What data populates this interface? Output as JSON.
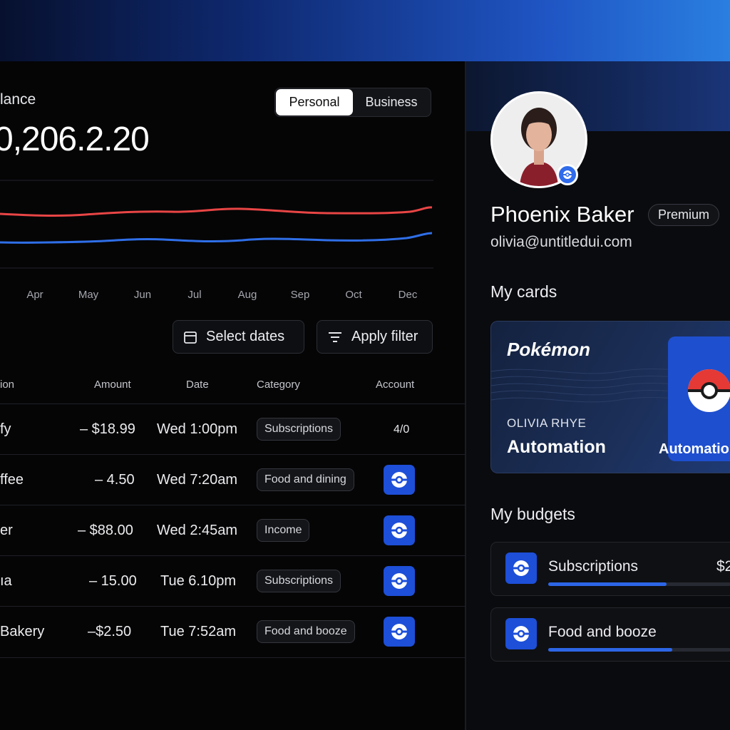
{
  "balance": {
    "label": "lance",
    "amount": "0,206.2.20",
    "toggle": {
      "personal": "Personal",
      "business": "Business",
      "active": "personal"
    }
  },
  "chart": {
    "months": [
      "Apr",
      "May",
      "Jun",
      "Jul",
      "Aug",
      "Sep",
      "Oct",
      "Dec"
    ],
    "colors": {
      "red": "#e94545",
      "blue": "#2f6fe8"
    }
  },
  "actions": {
    "select_dates": "Select dates",
    "apply_filter": "Apply filter"
  },
  "table": {
    "headers": {
      "description": "ion",
      "amount": "Amount",
      "date": "Date",
      "category": "Category",
      "account": "Account"
    },
    "rows": [
      {
        "name": "fy",
        "amount": "– $18.99",
        "date": "Wed 1:00pm",
        "category": "Subscriptions",
        "account_text": "4/0",
        "account_icon": "pokeball-icon"
      },
      {
        "name": "ffee",
        "amount": "– 4.50",
        "date": "Wed 7:20am",
        "category": "Food and dining",
        "account_text": "",
        "account_icon": "pokeball-icon"
      },
      {
        "name": "er",
        "amount": "– $88.00",
        "date": "Wed 2:45am",
        "category": "Income",
        "account_text": "",
        "account_icon": "pokeball-icon"
      },
      {
        "name": "ıa",
        "amount": "– 15.00",
        "date": "Tue 6.10pm",
        "category": "Subscriptions",
        "account_text": "",
        "account_icon": "pokeball-icon"
      },
      {
        "name": "Bakery",
        "amount": "–$2.50",
        "date": "Tue 7:52am",
        "category": "Food and booze",
        "account_text": "",
        "account_icon": "pokeball-icon"
      }
    ]
  },
  "profile": {
    "name": "Phoenix Baker",
    "badge": "Premium",
    "email": "olivia@untitledui.com"
  },
  "cards": {
    "title": "My cards",
    "brand": "Pokémon",
    "holder": "OLIVIA RHYE",
    "label": "Automation",
    "second_label": "Automatio"
  },
  "budgets": {
    "title": "My budgets",
    "items": [
      {
        "name": "Subscriptions",
        "amount": "$2",
        "progress": 0.65
      },
      {
        "name": "Food and booze",
        "amount": "",
        "progress": 0.68
      }
    ]
  }
}
